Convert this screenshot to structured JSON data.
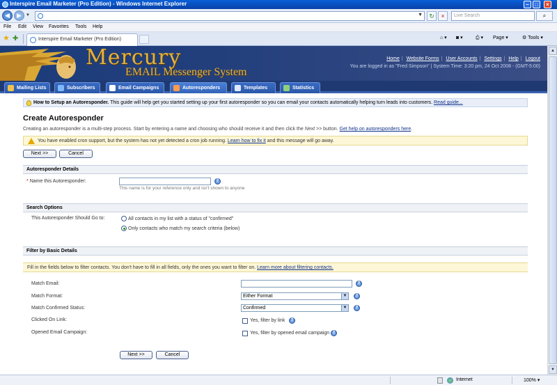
{
  "window": {
    "title": "Interspire Email Marketer (Pro Edition) - Windows Internet Explorer"
  },
  "browser": {
    "search_placeholder": "Live Search",
    "menu": [
      "File",
      "Edit",
      "View",
      "Favorites",
      "Tools",
      "Help"
    ],
    "tab_label": "Interspire Email Marketer (Pro Edition)",
    "commands": {
      "page": "Page",
      "tools": "Tools"
    },
    "status": {
      "zone": "Internet",
      "zoom": "100%"
    }
  },
  "header": {
    "logo_title": "Mercury",
    "logo_subtitle": "EMAIL Messenger System",
    "links": [
      "Home",
      "Website Forms",
      "User Accounts",
      "Settings",
      "Help",
      "Logout"
    ],
    "logged_in": "You are logged in as \"Fred Simpson\" | System Time: 3:20 pm, 24 Oct 2008 - (GMT-5:00)"
  },
  "nav": {
    "tabs": [
      {
        "label": "Mailing Lists",
        "color": "#f0c24a"
      },
      {
        "label": "Subscribers",
        "color": "#7fb8ff"
      },
      {
        "label": "Email Campaigns",
        "color": "#ffffff"
      },
      {
        "label": "Autoresponders",
        "color": "#ff9a4a"
      },
      {
        "label": "Templates",
        "color": "#dfe8ff"
      },
      {
        "label": "Statistics",
        "color": "#8fd17a"
      }
    ]
  },
  "page": {
    "tip_bold": "How to Setup an Autoresponder.",
    "tip_text": " This guide will help get you started setting up your first autoresponder so you can email your contacts automatically helping turn leads into customers. ",
    "tip_link": "Read guide...",
    "title": "Create Autoresponder",
    "intro_text": "Creating an autoresponder is a multi-step process. Start by entering a name and choosing who should receive it and then click the ",
    "intro_em": "Next >>",
    "intro_text2": " button. ",
    "intro_link": "Get help on autoresponders here",
    "intro_end": ".",
    "warning_text": "You have enabled cron support, but the system has not yet detected a cron job running. ",
    "warning_link": "Learn how to fix it",
    "warning_end": " and this message will go away.",
    "buttons": {
      "next": "Next >>",
      "cancel": "Cancel"
    }
  },
  "details": {
    "heading": "Autoresponder Details",
    "name_label": "Name this Autoresponder:",
    "name_value": "",
    "name_hint": "This name is for your reference only and isn't shown to anyone"
  },
  "search": {
    "heading": "Search Options",
    "goto_label": "This Autoresponder Should Go to:",
    "option_all": "All contacts in my list with a status of \"confirmed\"",
    "option_search": "Only contacts who match my search criteria (below)"
  },
  "filter": {
    "heading": "Filter by Basic Details",
    "info": "Fill in the fields below to filter contacts. You don't have to fill in all fields, only the ones you want to filter on. ",
    "info_link": "Learn more about filtering contacts.",
    "email_label": "Match Email:",
    "email_value": "",
    "format_label": "Match Format:",
    "format_value": "Either Format",
    "confirmed_label": "Match Confirmed Status:",
    "confirmed_value": "Confirmed",
    "clicked_label": "Clicked On Link:",
    "clicked_option": "Yes, filter by link",
    "opened_label": "Opened Email Campaign:",
    "opened_option": "Yes, filter by opened email campaign"
  }
}
